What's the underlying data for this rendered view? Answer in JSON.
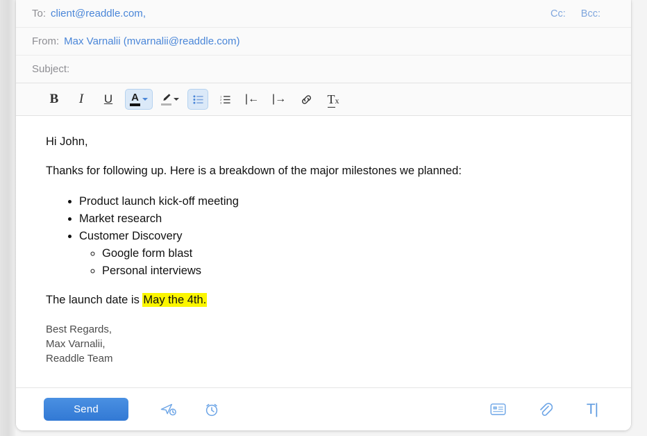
{
  "header": {
    "to": {
      "label": "To:",
      "value": "client@readdle.com",
      "trailing": ","
    },
    "from": {
      "label": "From:",
      "value": "Max Varnalii (mvarnalii@readdle.com)"
    },
    "subject": {
      "label": "Subject:",
      "value": "",
      "placeholder": ""
    },
    "cc_label": "Cc:",
    "bcc_label": "Bcc:"
  },
  "toolbar": {
    "bold": "B",
    "italic": "I",
    "underline": "U",
    "text_color": "A",
    "highlight": "highlighter",
    "bulleted_list": "bulleted-list",
    "numbered_list": "numbered-list",
    "outdent": "|←",
    "indent": "|→",
    "link": "link",
    "clear_formatting": "Tx",
    "active_buttons": [
      "text_color",
      "bulleted_list"
    ],
    "active_bg": "#dbe9f8",
    "active_border": "#b5d2ef"
  },
  "message": {
    "greeting": "Hi John,",
    "intro": "Thanks for following up. Here is a breakdown of the major milestones we planned:",
    "bullets": [
      {
        "text": "Product launch kick-off meeting",
        "children": []
      },
      {
        "text": "Market research",
        "children": []
      },
      {
        "text": "Customer Discovery",
        "children": [
          "Google form blast",
          "Personal interviews"
        ]
      }
    ],
    "launch_line_prefix": "The launch date is ",
    "launch_line_highlight": "May the 4th.",
    "highlight_color": "#fbf600",
    "signature": [
      "Best Regards,",
      "Max Varnalii,",
      "Readdle Team"
    ]
  },
  "actions": {
    "send_label": "Send",
    "send_color": "#3279d4",
    "send_later": "send-later",
    "remind": "alarm-clock",
    "template": "template-card",
    "attach": "paperclip",
    "format_text": "T|"
  }
}
